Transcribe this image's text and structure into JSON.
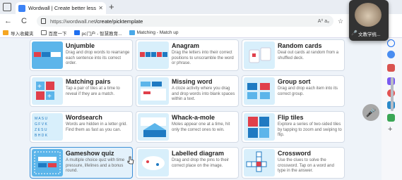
{
  "browser": {
    "tab_title": "Wordwall | Create better lessons",
    "tab_close": "✕",
    "new_tab": "+",
    "url_host": "https://wordwall.net",
    "url_path": "/create/picktemplate",
    "url_right": "A⁰  a₈"
  },
  "nav": {
    "back": "←",
    "reload": "C"
  },
  "bookmarks": [
    {
      "label": "导入收藏夹",
      "color": "#f5a623"
    },
    {
      "label": "百度一下",
      "color": "#ffffff"
    },
    {
      "label": "pc门户 - 智慧教育...",
      "color": "#1e6ff0"
    },
    {
      "label": "Matching - Match up",
      "color": "#4aa8e8"
    }
  ],
  "popup": {
    "label": "文教学统...",
    "mic": "🎤"
  },
  "colors": {
    "accent": "#3b8fd6",
    "card_border": "#d3dbe6",
    "thumb_blue": "#5cb5ea",
    "thumb_red": "#e0404b"
  },
  "templates": [
    {
      "title": "Unjumble",
      "desc": "Drag and drop words to rearrange each sentence into its correct order.",
      "icon": "unjumble-icon"
    },
    {
      "title": "Anagram",
      "desc": "Drag the letters into their correct positions to unscramble the word or phrase.",
      "icon": "anagram-icon"
    },
    {
      "title": "Random cards",
      "desc": "Deal out cards at random from a shuffled deck.",
      "icon": "random-cards-icon"
    },
    {
      "title": "Matching pairs",
      "desc": "Tap a pair of tiles at a time to reveal if they are a match.",
      "icon": "matching-pairs-icon"
    },
    {
      "title": "Missing word",
      "desc": "A cloze activity where you drag and drop words into blank spaces within a text.",
      "icon": "missing-word-icon"
    },
    {
      "title": "Group sort",
      "desc": "Drag and drop each item into its correct group.",
      "icon": "group-sort-icon"
    },
    {
      "title": "Wordsearch",
      "desc": "Words are hidden in a letter grid. Find them as fast as you can.",
      "icon": "wordsearch-icon"
    },
    {
      "title": "Whack-a-mole",
      "desc": "Moles appear one at a time, hit only the correct ones to win.",
      "icon": "whack-a-mole-icon"
    },
    {
      "title": "Flip tiles",
      "desc": "Explore a series of two-sided tiles by tapping to zoom and swiping to flip.",
      "icon": "flip-tiles-icon"
    },
    {
      "title": "Gameshow quiz",
      "desc": "A multiple choice quiz with time pressure, lifelines and a bonus round.",
      "icon": "gameshow-quiz-icon"
    },
    {
      "title": "Labelled diagram",
      "desc": "Drag and drop the pins to their correct place on the image.",
      "icon": "labelled-diagram-icon"
    },
    {
      "title": "Crossword",
      "desc": "Use the clues to solve the crossword. Tap on a word and type in the answer.",
      "icon": "crossword-icon"
    }
  ]
}
